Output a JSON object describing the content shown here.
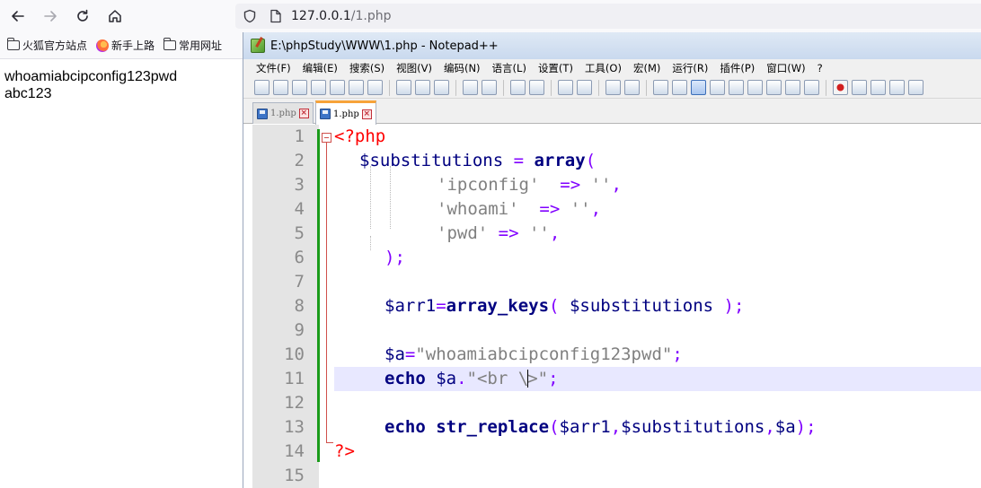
{
  "browser": {
    "url_host": "127.0.0.1",
    "url_path": "/1.php",
    "bookmarks": [
      "火狐官方站点",
      "新手上路",
      "常用网址"
    ]
  },
  "page": {
    "output_line1": "whoamiabcipconfig123pwd",
    "output_line2": "abc123"
  },
  "editor_window": {
    "title": "E:\\phpStudy\\WWW\\1.php - Notepad++",
    "menu": [
      "文件(F)",
      "编辑(E)",
      "搜索(S)",
      "视图(V)",
      "编码(N)",
      "语言(L)",
      "设置(T)",
      "工具(O)",
      "宏(M)",
      "运行(R)",
      "插件(P)",
      "窗口(W)",
      "?"
    ],
    "tabs": [
      {
        "label": "1.php",
        "active": false
      },
      {
        "label": "1.php",
        "active": true
      }
    ],
    "line_numbers": [
      "1",
      "2",
      "3",
      "4",
      "5",
      "6",
      "7",
      "8",
      "9",
      "10",
      "11",
      "12",
      "13",
      "14",
      "15"
    ],
    "code": {
      "l1_open": "<?php",
      "l2_var": "$substitutions",
      "l2_eq": " = ",
      "l2_fn": "array",
      "l2_paren": "(",
      "l3_key": "'ipconfig'",
      "l3_arrow": "  => ",
      "l3_val": "''",
      "l3_comma": ",",
      "l4_key": "'whoami'",
      "l4_arrow": "  => ",
      "l4_val": "''",
      "l4_comma": ",",
      "l5_key": "'pwd'",
      "l5_arrow": " => ",
      "l5_val": "''",
      "l5_comma": ",",
      "l6_close": ");",
      "l8_var": "$arr1",
      "l8_eq": "=",
      "l8_fn": "array_keys",
      "l8_open": "( ",
      "l8_arg": "$substitutions",
      "l8_close": " );",
      "l10_var": "$a",
      "l10_eq": "=",
      "l10_str": "\"whoamiabcipconfig123pwd\"",
      "l10_semi": ";",
      "l11_kw": "echo",
      "l11_var": " $a",
      "l11_dot": ".",
      "l11_str_a": "\"<br \\",
      "l11_str_b": ">\"",
      "l11_semi": ";",
      "l13_kw": "echo",
      "l13_fn": "str_replace",
      "l13_open": "(",
      "l13_a1": "$arr1",
      "l13_c1": ",",
      "l13_a2": "$substitutions",
      "l13_c2": ",",
      "l13_a3": "$a",
      "l13_close": ");",
      "l14_close": "?>"
    }
  }
}
